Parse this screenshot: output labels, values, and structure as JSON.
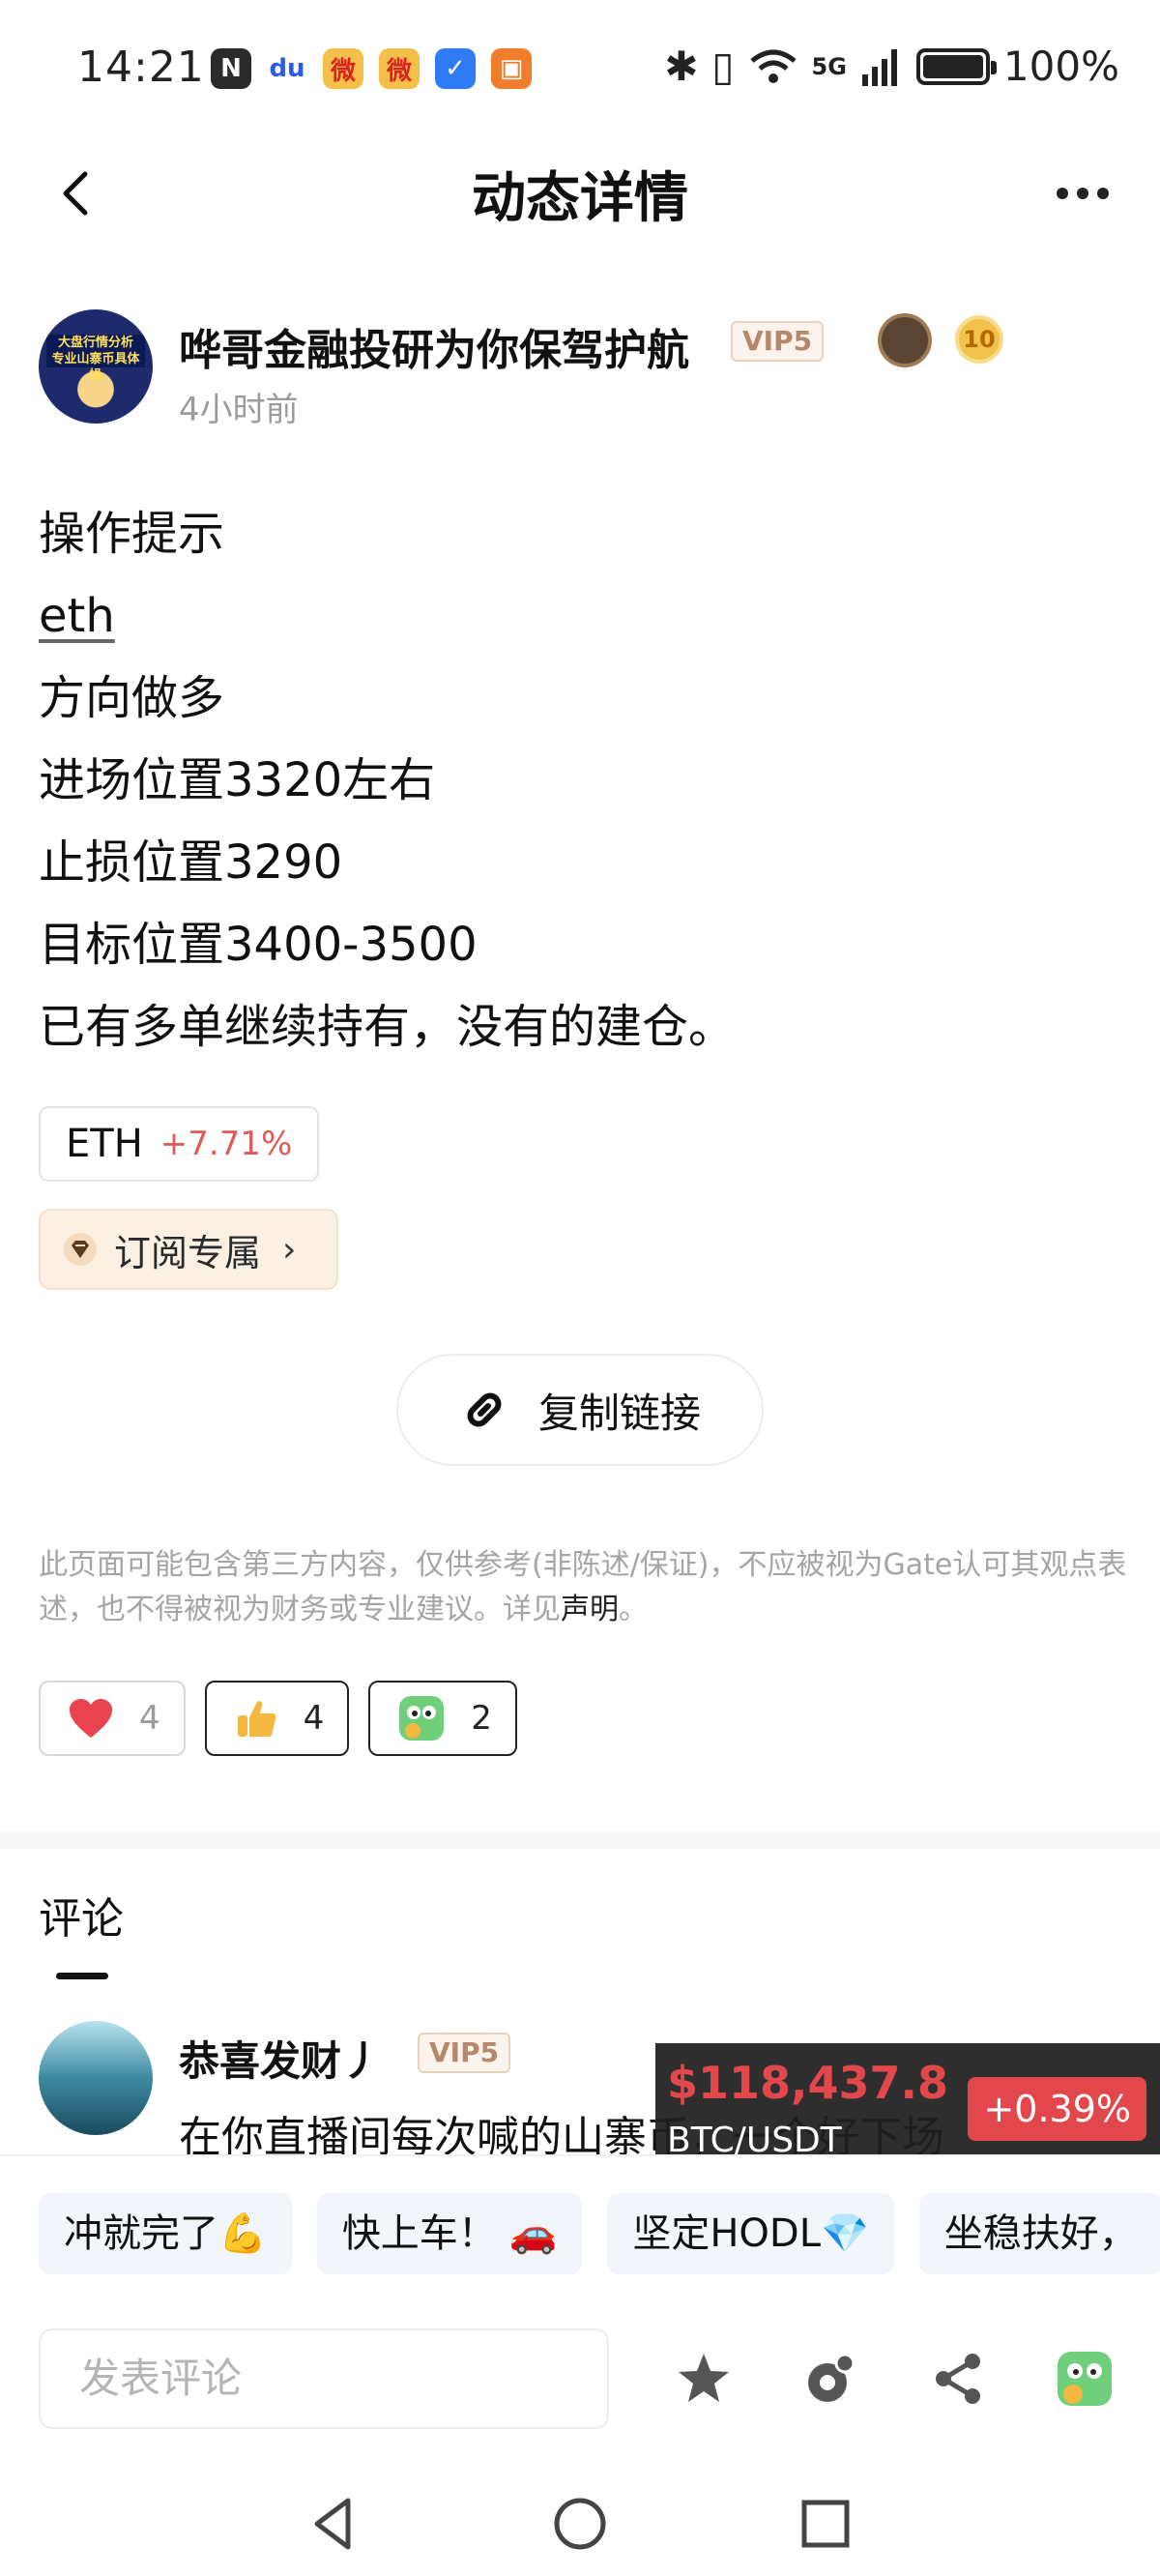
{
  "status_bar": {
    "time": "14:21",
    "network": "5G",
    "battery": "100%",
    "left_apps": [
      "N",
      "du",
      "微",
      "微",
      "✓",
      "▣"
    ]
  },
  "header": {
    "title": "动态详情"
  },
  "author": {
    "name": "哗哥金融投研为你保驾护航",
    "vip": "VIP5",
    "level": "10",
    "time": "4小时前",
    "avatar_text": "大盘行情分析\n专业山寨币具体操"
  },
  "post": {
    "lines": [
      "操作提示",
      "eth",
      "方向做多",
      "进场位置3320左右",
      "止损位置3290",
      "目标位置3400-3500",
      "已有多单继续持有，没有的建仓。"
    ]
  },
  "token": {
    "symbol": "ETH",
    "change": "+7.71%"
  },
  "subscribe": {
    "label": "订阅专属"
  },
  "copy_link": {
    "label": "复制链接"
  },
  "disclaimer": {
    "text": "此页面可能包含第三方内容，仅供参考(非陈述/保证)，不应被视为Gate认可其观点表述，也不得被视为财务或专业建议。详见",
    "link": "声明",
    "end": "。"
  },
  "reactions": [
    {
      "icon": "heart-icon",
      "count": "4"
    },
    {
      "icon": "thumbs-up-icon",
      "count": "4"
    },
    {
      "icon": "thinking-face-icon",
      "count": "2"
    }
  ],
  "comments": {
    "title": "评论",
    "items": [
      {
        "name": "恭喜发财丿",
        "vip": "VIP5",
        "text": "在你直播间每次喊的山寨币，一个好下场"
      }
    ]
  },
  "ticker": {
    "price": "$118,437.8",
    "pair": "BTC/USDT",
    "change": "+0.39%"
  },
  "quick_replies": [
    "冲就完了💪",
    "快上车！ 🚗",
    "坚定HODL💎",
    "坐稳扶好，"
  ],
  "bottom_bar": {
    "placeholder": "发表评论"
  },
  "colors": {
    "up_red": "#e2474b",
    "vip_text": "#b6876a",
    "subscribe_bg": "#fbf0e2"
  }
}
